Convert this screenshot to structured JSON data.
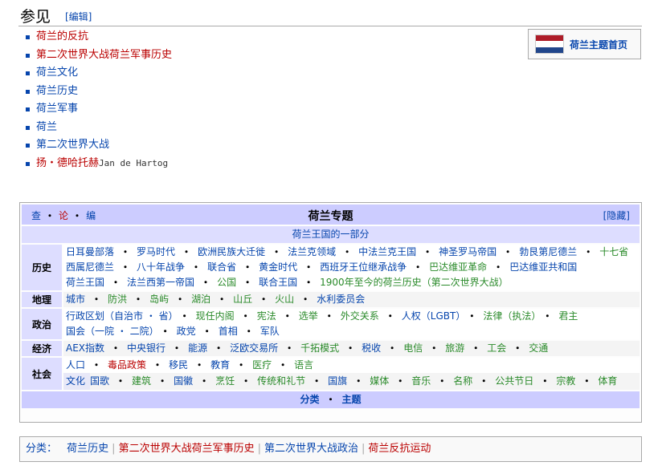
{
  "heading": {
    "title": "参见",
    "edit": "[编辑]"
  },
  "see_also": [
    {
      "text": "荷兰的反抗",
      "color": "red"
    },
    {
      "text": "第二次世界大战荷兰军事历史",
      "color": "red"
    },
    {
      "text": "荷兰文化",
      "color": "blue"
    },
    {
      "text": "荷兰历史",
      "color": "blue"
    },
    {
      "text": "荷兰军事",
      "color": "blue"
    },
    {
      "text": "荷兰",
      "color": "blue"
    },
    {
      "text": "第二次世界大战",
      "color": "blue"
    },
    {
      "text": "扬・德哈托赫",
      "color": "red",
      "extra": "Jan de Hartog"
    }
  ],
  "portal": {
    "label": "荷兰主题首页"
  },
  "navbox": {
    "vte": [
      "查",
      "论",
      "编"
    ],
    "title": "荷兰专题",
    "hide": "[隐藏]",
    "subtitle": "荷兰王国的一部分",
    "groups": [
      {
        "name": "历史",
        "lines": [
          [
            "日耳曼部落",
            "罗马时代",
            "欧洲民族大迁徙",
            "法兰克领域",
            "中法兰克王国",
            "神圣罗马帝国",
            "勃艮第尼德兰",
            "十七省"
          ],
          [
            "西属尼德兰",
            "八十年战争",
            "联合省",
            "黄金时代",
            "西班牙王位继承战争",
            "巴达维亚革命",
            "巴达维亚共和国"
          ],
          [
            "荷兰王国",
            "法兰西第一帝国",
            "公国",
            "联合王国",
            "1900年至今的荷兰历史（第二次世界大战）"
          ]
        ]
      },
      {
        "name": "地理",
        "lines": [
          [
            "城市",
            "防洪",
            "岛屿",
            "湖泊",
            "山丘",
            "火山",
            "水利委员会"
          ]
        ]
      },
      {
        "name": "政治",
        "lines": [
          [
            "行政区划（自治市 ・ 省）",
            "现任内阁",
            "宪法",
            "选举",
            "外交关系",
            "人权（LGBT）",
            "法律（执法）",
            "君主"
          ],
          [
            "国会（一院 ・ 二院）",
            "政党",
            "首相",
            "军队"
          ]
        ]
      },
      {
        "name": "经济",
        "lines": [
          [
            "AEX指数",
            "中央银行",
            "能源",
            "泛欧交易所",
            "千拓模式",
            "税收",
            "电信",
            "旅游",
            "工会",
            "交通"
          ]
        ]
      },
      {
        "name": "社会",
        "lines": [
          [
            "人口",
            "毒品政策",
            "移民",
            "教育",
            "医疗",
            "语言"
          ]
        ],
        "culture_label": "文化",
        "culture": [
          "国歌",
          "建筑",
          "国徽",
          "烹饪",
          "传统和礼节",
          "国旗",
          "媒体",
          "音乐",
          "名称",
          "公共节日",
          "宗教",
          "体育"
        ]
      }
    ],
    "footer": [
      "分类",
      "主题"
    ]
  },
  "categories": {
    "label": "分类：",
    "items": [
      "荷兰历史",
      "第二次世界大战荷兰军事历史",
      "第二次世界大战政治",
      "荷兰反抗运动"
    ]
  },
  "colors": {
    "link": "#0645ad",
    "redlink": "#ba0000",
    "header_bg": "#ccf",
    "group_bg": "#ddf"
  }
}
